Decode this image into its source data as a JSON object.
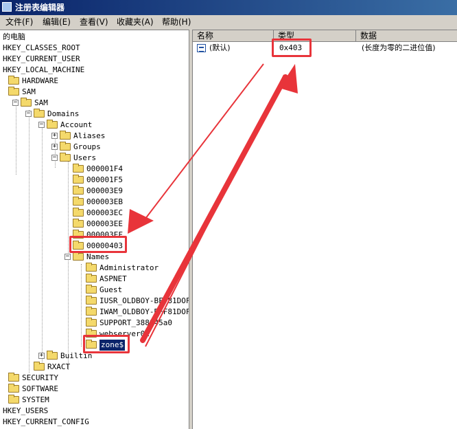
{
  "window": {
    "title": "注册表编辑器"
  },
  "menu": [
    {
      "label": "文件(F)"
    },
    {
      "label": "编辑(E)"
    },
    {
      "label": "查看(V)"
    },
    {
      "label": "收藏夹(A)"
    },
    {
      "label": "帮助(H)"
    }
  ],
  "tree": {
    "root": "的电脑",
    "hkcr": "HKEY_CLASSES_ROOT",
    "hkcu": "HKEY_CURRENT_USER",
    "hklm": "HKEY_LOCAL_MACHINE",
    "hardware": "HARDWARE",
    "sam": "SAM",
    "sam2": "SAM",
    "domains": "Domains",
    "account": "Account",
    "aliases": "Aliases",
    "groups": "Groups",
    "users": "Users",
    "user_keys": [
      "000001F4",
      "000001F5",
      "000003E9",
      "000003EB",
      "000003EC",
      "000003EE",
      "000003EF",
      "00000403"
    ],
    "names": "Names",
    "name_keys": [
      "Administrator",
      "ASPNET",
      "Guest",
      "IUSR_OLDBOY-BFF81DOF",
      "IWAM_OLDBOY-BFF81DOF",
      "SUPPORT_388945a0",
      "webserver01",
      "zone$"
    ],
    "builtin": "Builtin",
    "rxact": "RXACT",
    "security": "SECURITY",
    "software": "SOFTWARE",
    "system": "SYSTEM",
    "hku": "HKEY_USERS",
    "hkcc": "HKEY_CURRENT_CONFIG"
  },
  "list": {
    "columns": [
      "名称",
      "类型",
      "数据"
    ],
    "rows": [
      {
        "name": "(默认)",
        "type": "0x403",
        "data": "(长度为零的二进位值)"
      }
    ]
  },
  "colors": {
    "highlight": "#e8343a",
    "title_bar": "#0a246a",
    "folder": "#f4d96b"
  },
  "icons": {
    "folder": "folder-icon",
    "binary_value": "binary-value-icon"
  }
}
